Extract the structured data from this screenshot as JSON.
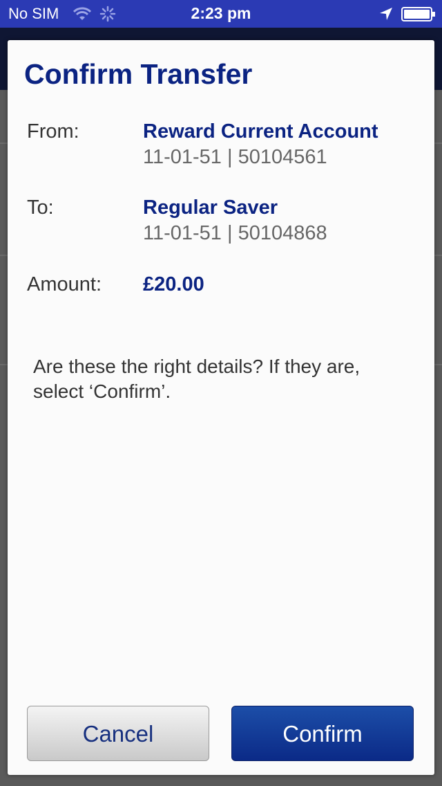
{
  "status_bar": {
    "carrier": "No SIM",
    "time": "2:23 pm",
    "icons": [
      "wifi-icon",
      "activity-icon",
      "location-icon",
      "battery-icon"
    ]
  },
  "dialog": {
    "title": "Confirm Transfer",
    "from": {
      "label": "From:",
      "account_name": "Reward Current Account",
      "account_details": "11-01-51 | 50104561"
    },
    "to": {
      "label": "To:",
      "account_name": "Regular Saver",
      "account_details": "11-01-51 | 50104868"
    },
    "amount": {
      "label": "Amount:",
      "value": "£20.00"
    },
    "prompt": "Are these the right details? If they are, select ‘Confirm’.",
    "buttons": {
      "cancel": "Cancel",
      "confirm": "Confirm"
    }
  },
  "colors": {
    "status_bar": "#2b3ab4",
    "accent": "#0b2382",
    "confirm_button": "#0b2a87"
  }
}
